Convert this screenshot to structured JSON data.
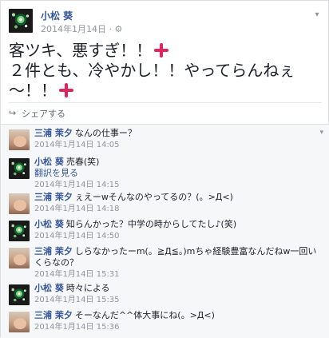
{
  "post": {
    "author": "小松 葵",
    "date": "2014年1月14日",
    "audience_icon": "gear-icon",
    "lines": [
      "客ツキ、悪すぎ！！",
      "２件とも、冷やかし！！やってらんねぇ",
      "～！！"
    ],
    "emoji": "anger-symbol",
    "share_label": "シェアする"
  },
  "comments": [
    {
      "author": "三浦 茉夕",
      "text": "なんの仕事ー？",
      "time": "2014年1月14日 14:05",
      "avatar": "child"
    },
    {
      "author": "小松 葵",
      "text": "売春(笑)",
      "subline": "翻訳を見る",
      "time": "2014年1月14日 14:15",
      "avatar": "fireworks"
    },
    {
      "author": "三浦 茉夕",
      "text": "ぇえーwそんなのやってるの？(。>Д<)",
      "time": "2014年1月14日 14:18",
      "avatar": "child"
    },
    {
      "author": "小松 葵",
      "text": "知らんかった？中学の時からしてたし♪(笑)",
      "time": "2014年1月14日 14:50",
      "avatar": "fireworks"
    },
    {
      "author": "三浦 茉夕",
      "text": "しらなかったーm(。≧Д≦。)mちゃ経験豊富なんだねw一回いくらなの？",
      "time": "2014年1月14日 15:31",
      "avatar": "child"
    },
    {
      "author": "小松 葵",
      "text": "時々による",
      "time": "2014年1月14日 15:35",
      "avatar": "fireworks"
    },
    {
      "author": "三浦 茉夕",
      "text": "そーなんだ^^体大事にね(。>Д<)",
      "time": "2014年1月14日 15:36",
      "avatar": "child"
    }
  ],
  "colors": {
    "link": "#365899",
    "meta": "#90949c",
    "anger": "#e0245e"
  }
}
